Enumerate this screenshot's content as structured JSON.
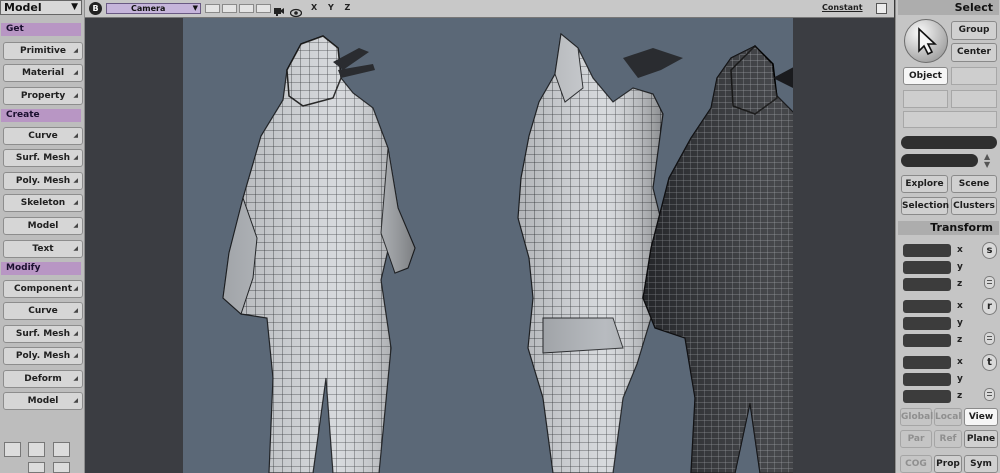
{
  "left_panel": {
    "mode": "Model",
    "sections": [
      {
        "label": "Get",
        "buttons": [
          "Primitive",
          "Material",
          "Property"
        ]
      },
      {
        "label": "Create",
        "buttons": [
          "Curve",
          "Surf. Mesh",
          "Poly. Mesh",
          "Skeleton",
          "Model",
          "Text"
        ]
      },
      {
        "label": "Modify",
        "buttons": [
          "Component",
          "Curve",
          "Surf. Mesh",
          "Poly. Mesh",
          "Deform",
          "Model"
        ]
      }
    ]
  },
  "viewport": {
    "badge": "B",
    "camera": "Camera",
    "axes": "X Y Z",
    "shading": "Constant"
  },
  "right_panel": {
    "title": "Select",
    "group": "Group",
    "center": "Center",
    "object": "Object",
    "explore": "Explore",
    "scene": "Scene",
    "selection": "Selection",
    "clusters": "Clusters",
    "transform_title": "Transform",
    "axis_x": "x",
    "axis_y": "y",
    "axis_z": "z",
    "scale_label": "s",
    "rotate_label": "r",
    "translate_label": "t",
    "global": "Global",
    "local": "Local",
    "view": "View",
    "par": "Par",
    "ref": "Ref",
    "plane": "Plane",
    "cog": "COG",
    "prop": "Prop",
    "sym": "Sym"
  },
  "colors": {
    "section_header": "#b896c4",
    "camera_field": "#c6b5db",
    "viewport_backdrop": "#5b6877"
  }
}
